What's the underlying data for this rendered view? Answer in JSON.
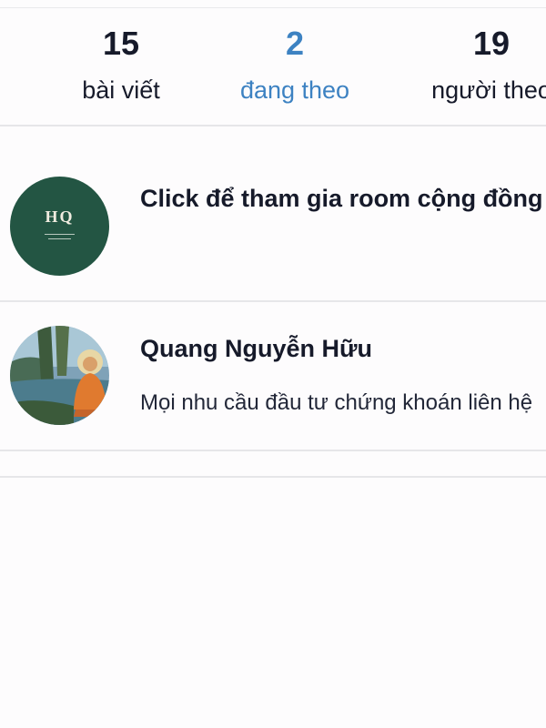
{
  "stats": {
    "posts": {
      "count": "15",
      "label": "bài viết"
    },
    "following": {
      "count": "2",
      "label": "đang theo"
    },
    "followers": {
      "count": "19",
      "label": "người theo"
    }
  },
  "following_list": [
    {
      "title": "Click để tham gia room cộng đồng",
      "subtitle": "",
      "avatar": "HQ"
    },
    {
      "title": "Quang Nguyễn Hữu",
      "subtitle": "Mọi nhu cầu đầu tư chứng khoán liên hệ",
      "avatar": "buddha-meditating-image"
    }
  ],
  "colors": {
    "accent": "#3d82c2",
    "text": "#161a2a",
    "divider": "#e6e6e9",
    "hq_avatar_bg": "#235543"
  }
}
